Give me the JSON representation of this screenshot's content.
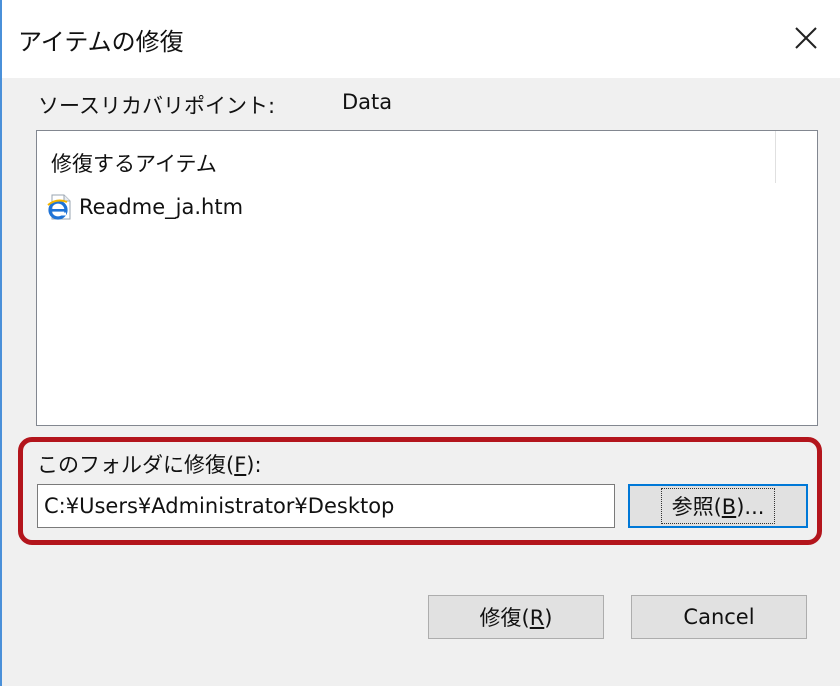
{
  "window": {
    "title": "アイテムの修復",
    "close_icon": "close-icon"
  },
  "source": {
    "label": "ソースリカバリポイント:",
    "value": "Data"
  },
  "items_list": {
    "header": "修復するアイテム",
    "items": [
      {
        "icon": "ie-html-file-icon",
        "name": "Readme_ja.htm"
      }
    ]
  },
  "restore_to": {
    "label_prefix": "このフォルダに修復(",
    "label_accel": "F",
    "label_suffix": "):",
    "path_value": "C:¥Users¥Administrator¥Desktop",
    "browse_prefix": "参照(",
    "browse_accel": "B",
    "browse_suffix": ")..."
  },
  "buttons": {
    "restore_prefix": "修復(",
    "restore_accel": "R",
    "restore_suffix": ")",
    "cancel": "Cancel"
  },
  "colors": {
    "highlight": "#b3151c",
    "focus": "#0078d7"
  }
}
